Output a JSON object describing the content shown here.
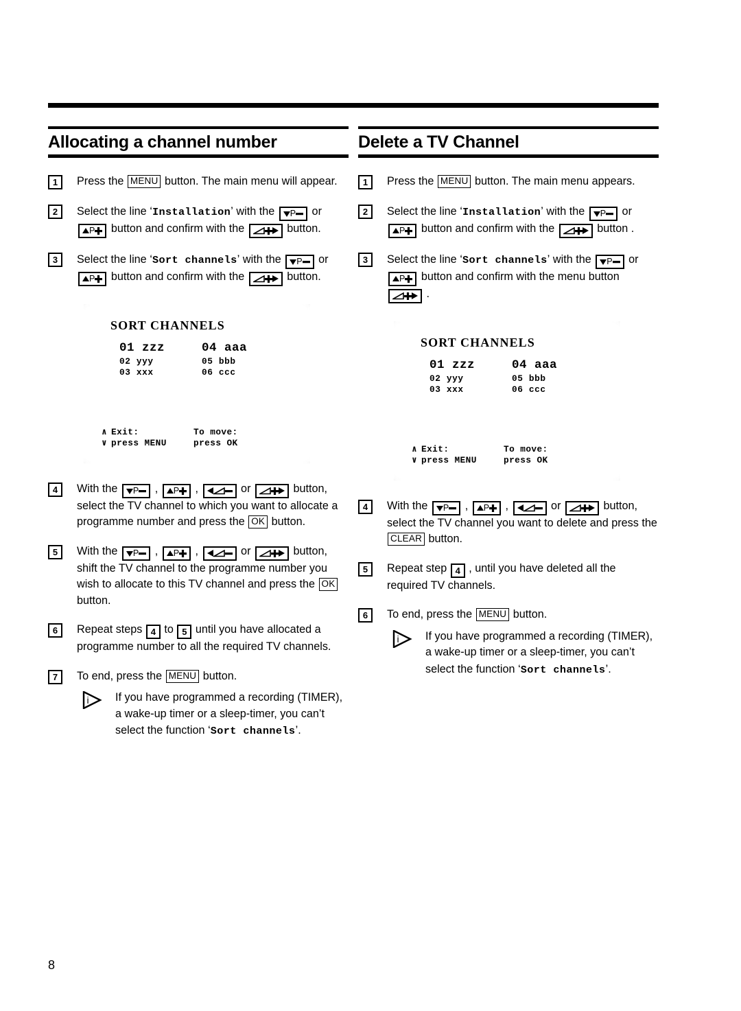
{
  "page": {
    "number": "8"
  },
  "columns": [
    {
      "title": "Allocating a channel number",
      "steps": [
        {
          "num": "1",
          "parts": [
            {
              "t": "text",
              "v": "Press the "
            },
            {
              "t": "key",
              "v": "MENU"
            },
            {
              "t": "text",
              "v": " button. The main menu will appear."
            }
          ]
        },
        {
          "num": "2",
          "parts": [
            {
              "t": "text",
              "v": "Select the line "
            },
            {
              "t": "mono",
              "v": "Installation"
            },
            {
              "t": "text",
              "v": " with the "
            },
            {
              "t": "gkey",
              "v": "down-p-minus"
            },
            {
              "t": "text",
              "v": " or "
            },
            {
              "t": "gkey",
              "v": "up-p-plus"
            },
            {
              "t": "text",
              "v": " button and confirm with the "
            },
            {
              "t": "gkey",
              "v": "vol-plus-right"
            },
            {
              "t": "text",
              "v": " button."
            }
          ]
        },
        {
          "num": "3",
          "parts": [
            {
              "t": "text",
              "v": "Select the line "
            },
            {
              "t": "mono",
              "v": "Sort channels"
            },
            {
              "t": "text",
              "v": " with the "
            },
            {
              "t": "gkey",
              "v": "down-p-minus"
            },
            {
              "t": "text",
              "v": " or "
            },
            {
              "t": "gkey",
              "v": "up-p-plus"
            },
            {
              "t": "text",
              "v": " button and confirm with the "
            },
            {
              "t": "gkey",
              "v": "vol-plus-right"
            },
            {
              "t": "text",
              "v": " button."
            }
          ]
        }
      ],
      "tv": {
        "title": "SORT CHANNELS",
        "rows": [
          {
            "size": "large",
            "cells": [
              "01 zzz",
              "04 aaa"
            ]
          },
          {
            "size": "small",
            "cells": [
              "02 yyy",
              "05 bbb"
            ]
          },
          {
            "size": "small",
            "cells": [
              "03 xxx",
              "06 ccc"
            ]
          }
        ],
        "footer": [
          {
            "arrow": "∧",
            "left": "Exit:",
            "right": "To move:"
          },
          {
            "arrow": "∨",
            "left": "press MENU",
            "right": "press OK"
          }
        ]
      },
      "steps_after": [
        {
          "num": "4",
          "parts": [
            {
              "t": "text",
              "v": "With the "
            },
            {
              "t": "gkey",
              "v": "down-p-minus"
            },
            {
              "t": "text",
              "v": " , "
            },
            {
              "t": "gkey",
              "v": "up-p-plus"
            },
            {
              "t": "text",
              "v": " , "
            },
            {
              "t": "gkey",
              "v": "left-vol-minus"
            },
            {
              "t": "text",
              "v": " or "
            },
            {
              "t": "gkey",
              "v": "vol-plus-right"
            },
            {
              "t": "text",
              "v": " button, select the TV channel to which you want to allocate a programme number and press the "
            },
            {
              "t": "key",
              "v": "OK"
            },
            {
              "t": "text",
              "v": " button."
            }
          ]
        },
        {
          "num": "5",
          "parts": [
            {
              "t": "text",
              "v": "With the "
            },
            {
              "t": "gkey",
              "v": "down-p-minus"
            },
            {
              "t": "text",
              "v": " , "
            },
            {
              "t": "gkey",
              "v": "up-p-plus"
            },
            {
              "t": "text",
              "v": " , "
            },
            {
              "t": "gkey",
              "v": "left-vol-minus"
            },
            {
              "t": "text",
              "v": " or "
            },
            {
              "t": "gkey",
              "v": "vol-plus-right"
            },
            {
              "t": "text",
              "v": " button, shift the TV channel to the programme number you wish to allocate to this TV channel and press the "
            },
            {
              "t": "key",
              "v": "OK"
            },
            {
              "t": "text",
              "v": " button."
            }
          ]
        },
        {
          "num": "6",
          "parts": [
            {
              "t": "text",
              "v": "Repeat steps "
            },
            {
              "t": "stepref",
              "v": "4"
            },
            {
              "t": "text",
              "v": " to "
            },
            {
              "t": "stepref",
              "v": "5"
            },
            {
              "t": "text",
              "v": " until you have allocated a programme number to all the required TV channels."
            }
          ]
        },
        {
          "num": "7",
          "parts": [
            {
              "t": "text",
              "v": "To end, press the "
            },
            {
              "t": "key",
              "v": "MENU"
            },
            {
              "t": "text",
              "v": " button."
            }
          ],
          "note": [
            {
              "t": "text",
              "v": "If you have programmed a recording (TIMER), a wake-up timer or a sleep-timer, you can’t select the function "
            },
            {
              "t": "mono",
              "v": "Sort channels"
            },
            {
              "t": "text",
              "v": "."
            }
          ]
        }
      ]
    },
    {
      "title": "Delete a TV Channel",
      "steps": [
        {
          "num": "1",
          "parts": [
            {
              "t": "text",
              "v": "Press the "
            },
            {
              "t": "key",
              "v": "MENU"
            },
            {
              "t": "text",
              "v": " button. The main menu appears."
            }
          ]
        },
        {
          "num": "2",
          "parts": [
            {
              "t": "text",
              "v": "Select the line "
            },
            {
              "t": "mono",
              "v": "Installation"
            },
            {
              "t": "text",
              "v": " with the "
            },
            {
              "t": "gkey",
              "v": "down-p-minus"
            },
            {
              "t": "text",
              "v": " or "
            },
            {
              "t": "gkey",
              "v": "up-p-plus"
            },
            {
              "t": "text",
              "v": " button and confirm with the "
            },
            {
              "t": "gkey",
              "v": "vol-plus-right"
            },
            {
              "t": "text",
              "v": " button ."
            }
          ]
        },
        {
          "num": "3",
          "parts": [
            {
              "t": "text",
              "v": "Select the line "
            },
            {
              "t": "mono",
              "v": "Sort channels"
            },
            {
              "t": "text",
              "v": " with the "
            },
            {
              "t": "gkey",
              "v": "down-p-minus"
            },
            {
              "t": "text",
              "v": " or "
            },
            {
              "t": "gkey",
              "v": "up-p-plus"
            },
            {
              "t": "text",
              "v": " button and confirm with the menu button "
            },
            {
              "t": "gkey",
              "v": "vol-plus-right"
            },
            {
              "t": "text",
              "v": " ."
            }
          ]
        }
      ],
      "tv": {
        "title": "SORT CHANNELS",
        "rows": [
          {
            "size": "large",
            "cells": [
              "01 zzz",
              "04 aaa"
            ]
          },
          {
            "size": "small",
            "cells": [
              "02 yyy",
              "05 bbb"
            ]
          },
          {
            "size": "small",
            "cells": [
              "03 xxx",
              "06 ccc"
            ]
          }
        ],
        "footer": [
          {
            "arrow": "∧",
            "left": "Exit:",
            "right": "To move:"
          },
          {
            "arrow": "∨",
            "left": "press MENU",
            "right": "press OK"
          }
        ]
      },
      "steps_after": [
        {
          "num": "4",
          "parts": [
            {
              "t": "text",
              "v": "With the "
            },
            {
              "t": "gkey",
              "v": "down-p-minus"
            },
            {
              "t": "text",
              "v": " , "
            },
            {
              "t": "gkey",
              "v": "up-p-plus"
            },
            {
              "t": "text",
              "v": " , "
            },
            {
              "t": "gkey",
              "v": "left-vol-minus"
            },
            {
              "t": "text",
              "v": " or "
            },
            {
              "t": "gkey",
              "v": "vol-plus-right"
            },
            {
              "t": "text",
              "v": " button, select the TV channel you want to delete and press the "
            },
            {
              "t": "key",
              "v": "CLEAR"
            },
            {
              "t": "text",
              "v": " button."
            }
          ]
        },
        {
          "num": "5",
          "parts": [
            {
              "t": "text",
              "v": "Repeat step "
            },
            {
              "t": "stepref",
              "v": "4"
            },
            {
              "t": "text",
              "v": " , until you have deleted all the required TV channels."
            }
          ]
        },
        {
          "num": "6",
          "parts": [
            {
              "t": "text",
              "v": "To end, press the "
            },
            {
              "t": "key",
              "v": "MENU"
            },
            {
              "t": "text",
              "v": " button."
            }
          ],
          "note": [
            {
              "t": "text",
              "v": "If you have programmed a recording (TIMER), a wake-up timer or a sleep-timer, you can’t select the function "
            },
            {
              "t": "mono",
              "v": "Sort channels"
            },
            {
              "t": "text",
              "v": "."
            }
          ]
        }
      ]
    }
  ],
  "glyph_keys": {
    "down-p-minus": {
      "name": "channel-down-key",
      "label": "P",
      "pre": "down-triangle",
      "post": "minus"
    },
    "up-p-plus": {
      "name": "channel-up-key",
      "label": "P",
      "pre": "up-triangle",
      "post": "plus"
    },
    "left-vol-minus": {
      "name": "volume-down-key",
      "label": "",
      "pre": "left-triangle",
      "mid": "volume-wedge",
      "post": "minus"
    },
    "vol-plus-right": {
      "name": "volume-up-key",
      "label": "",
      "pre": "volume-wedge",
      "post": "plus-right"
    }
  }
}
